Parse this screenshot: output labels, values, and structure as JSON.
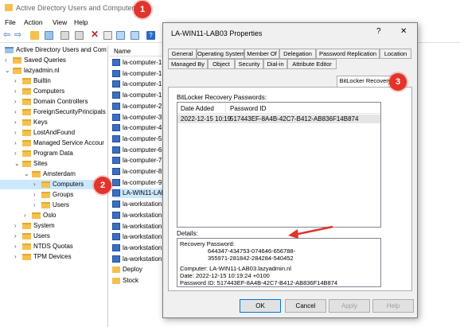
{
  "app": {
    "title": "Active Directory Users and Computers"
  },
  "menu": [
    "File",
    "Action",
    "View",
    "Help"
  ],
  "tree": {
    "root": "Active Directory Users and Com",
    "items": [
      {
        "label": "Saved Queries",
        "indent": 1,
        "chev": ">"
      },
      {
        "label": "lazyadmin.nl",
        "indent": 1,
        "chev": "v"
      },
      {
        "label": "Builtin",
        "indent": 2,
        "chev": ">"
      },
      {
        "label": "Computers",
        "indent": 2,
        "chev": ">"
      },
      {
        "label": "Domain Controllers",
        "indent": 2,
        "chev": ">"
      },
      {
        "label": "ForeignSecurityPrincipals",
        "indent": 2,
        "chev": ">"
      },
      {
        "label": "Keys",
        "indent": 2,
        "chev": ">"
      },
      {
        "label": "LostAndFound",
        "indent": 2,
        "chev": ">"
      },
      {
        "label": "Managed Service Accour",
        "indent": 2,
        "chev": ">"
      },
      {
        "label": "Program Data",
        "indent": 2,
        "chev": ">"
      },
      {
        "label": "Sites",
        "indent": 2,
        "chev": "v"
      },
      {
        "label": "Amsterdam",
        "indent": 3,
        "chev": "v"
      },
      {
        "label": "Computers",
        "indent": 4,
        "chev": ">",
        "selected": true
      },
      {
        "label": "Groups",
        "indent": 4,
        "chev": ">"
      },
      {
        "label": "Users",
        "indent": 4,
        "chev": ">"
      },
      {
        "label": "Oslo",
        "indent": 3,
        "chev": ">"
      },
      {
        "label": "System",
        "indent": 2,
        "chev": ">"
      },
      {
        "label": "Users",
        "indent": 2,
        "chev": ">"
      },
      {
        "label": "NTDS Quotas",
        "indent": 2,
        "chev": ">"
      },
      {
        "label": "TPM Devices",
        "indent": 2,
        "chev": ">"
      }
    ]
  },
  "list": {
    "header": "Name",
    "items": [
      {
        "label": "la-computer-1",
        "type": "computer"
      },
      {
        "label": "la-computer-1",
        "type": "computer"
      },
      {
        "label": "la-computer-1",
        "type": "computer"
      },
      {
        "label": "la-computer-1",
        "type": "computer"
      },
      {
        "label": "la-computer-2",
        "type": "computer"
      },
      {
        "label": "la-computer-3",
        "type": "computer"
      },
      {
        "label": "la-computer-4",
        "type": "computer"
      },
      {
        "label": "la-computer-5",
        "type": "computer"
      },
      {
        "label": "la-computer-6",
        "type": "computer"
      },
      {
        "label": "la-computer-7",
        "type": "computer"
      },
      {
        "label": "la-computer-8",
        "type": "computer"
      },
      {
        "label": "la-computer-9",
        "type": "computer"
      },
      {
        "label": "LA-WIN11-LAB",
        "type": "computer",
        "selected": true
      },
      {
        "label": "la-workstation",
        "type": "computer"
      },
      {
        "label": "la-workstation",
        "type": "computer"
      },
      {
        "label": "la-workstation",
        "type": "computer"
      },
      {
        "label": "la-workstation",
        "type": "computer"
      },
      {
        "label": "la-workstation",
        "type": "computer"
      },
      {
        "label": "la-workstation",
        "type": "computer"
      },
      {
        "label": "Deploy",
        "type": "folder"
      },
      {
        "label": "Stock",
        "type": "folder"
      }
    ]
  },
  "dialog": {
    "title": "LA-WIN11-LAB03 Properties",
    "help_glyph": "?",
    "close_glyph": "✕",
    "tabs_row1": [
      "General",
      "Operating System",
      "Member Of",
      "Delegation",
      "Password Replication",
      "Location"
    ],
    "tabs_row2": [
      "Managed By",
      "Object",
      "Security",
      "Dial-in",
      "Attribute Editor",
      "BitLocker Recovery"
    ],
    "recovery_label": "BitLocker Recovery Passwords:",
    "col_date": "Date Added",
    "col_pwid": "Password ID",
    "row_date": "2022-12-15 10:19",
    "row_pwid": "517443EF-8A4B-42C7-B412-AB836F14B874",
    "details_label": "Details:",
    "details": {
      "rp_label": "Recovery Password:",
      "rp_line1": "644347-434753-074646-656788-",
      "rp_line2": "355971-281842-284284-540452",
      "computer": "Computer:  LA-WIN11-LAB03.lazyadmin.nl",
      "date": "Date:  2022-12-15 10:19:24 +0100",
      "pwid": "Password ID:  517443EF-8A4B-42C7-B412-AB836F14B874"
    },
    "buttons": {
      "ok": "OK",
      "cancel": "Cancel",
      "apply": "Apply",
      "help": "Help"
    }
  },
  "badges": [
    "1",
    "2",
    "3"
  ],
  "colors": {
    "badge": "#e2342b",
    "selection": "#cce8ff",
    "folder": "#f5c04f"
  }
}
